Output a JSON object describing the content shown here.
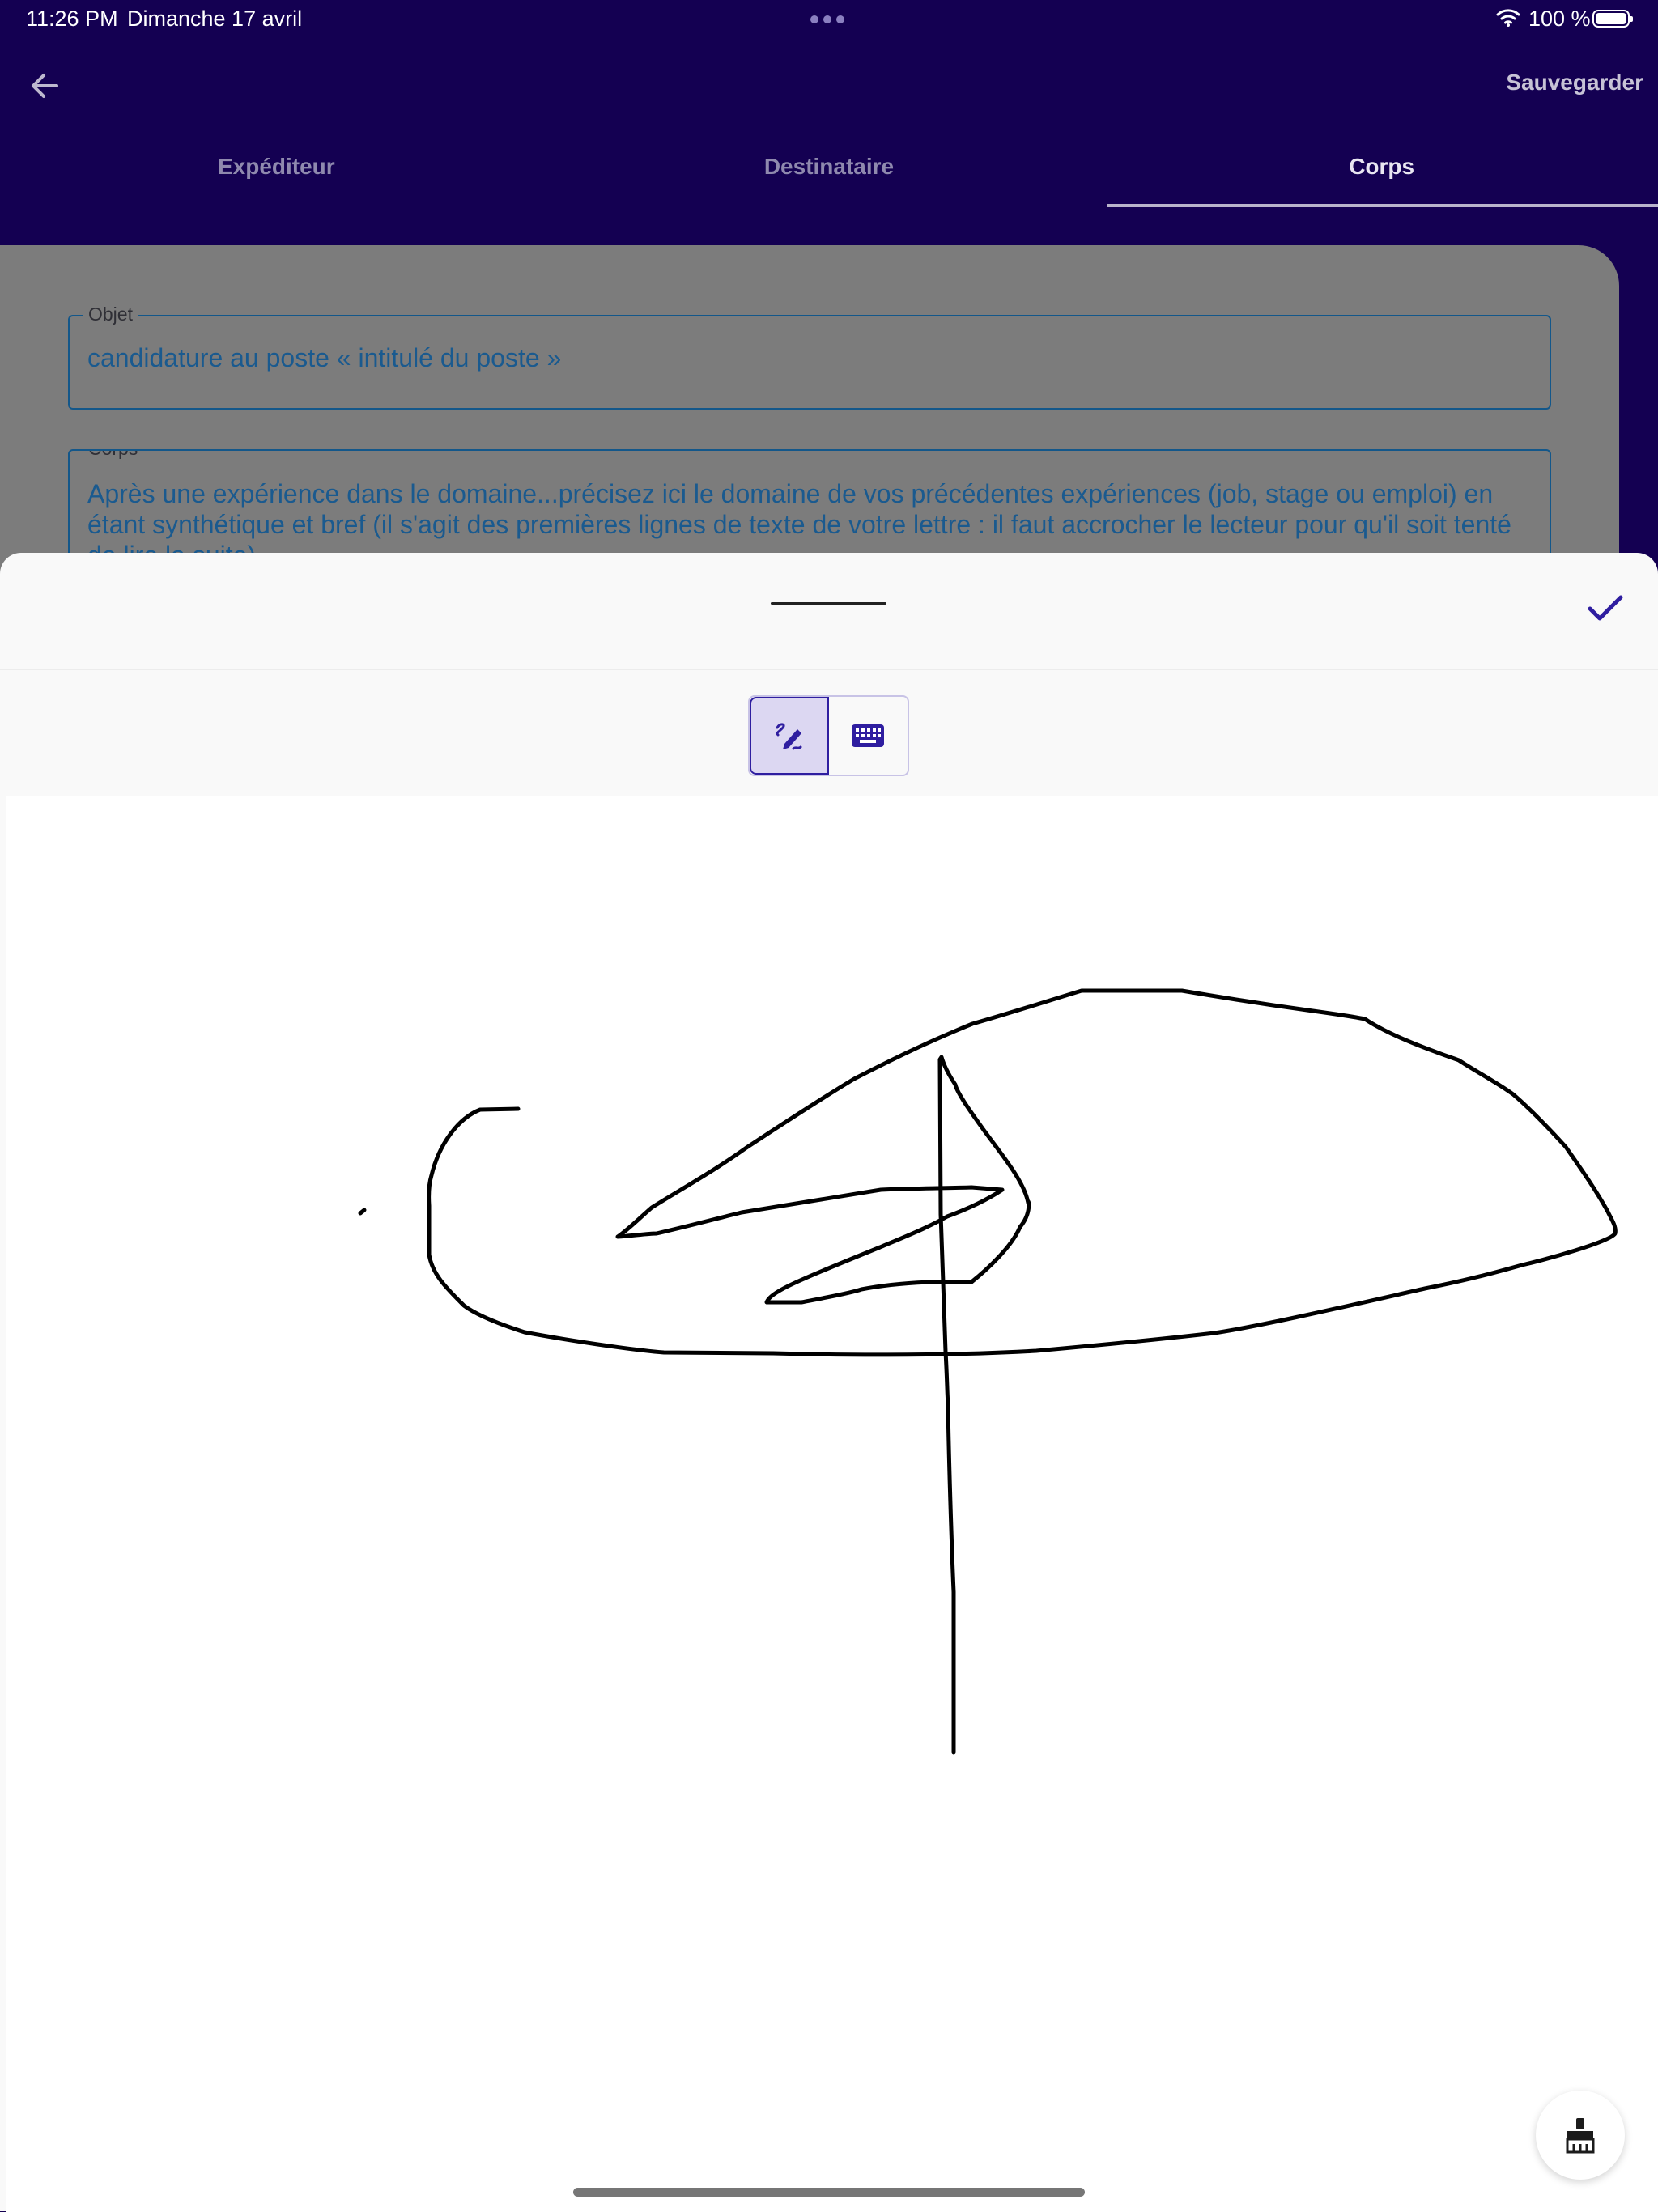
{
  "status_bar": {
    "time": "11:26 PM",
    "date": "Dimanche 17 avril",
    "battery": "100 %",
    "icons": [
      "more-dots-icon",
      "wifi-icon",
      "battery-icon"
    ]
  },
  "header": {
    "save_label": "Sauvegarder",
    "back_icon": "arrow-left-icon"
  },
  "tabs": [
    {
      "label": "Expéditeur",
      "active": false
    },
    {
      "label": "Destinataire",
      "active": false
    },
    {
      "label": "Corps",
      "active": true
    }
  ],
  "form": {
    "objet": {
      "label": "Objet",
      "value": "candidature au poste « intitulé du poste »"
    },
    "corps": {
      "label": "Corps",
      "value": "Après une expérience dans le domaine...précisez ici le domaine de vos précédentes expériences (job, stage ou emploi) en étant synthétique et bref (il s'agit des premières lignes de texte de votre lettre : il faut accrocher le lecteur pour qu'il soit tenté de lire la suite)"
    }
  },
  "signature_sheet": {
    "confirm_icon": "checkmark-icon",
    "modes": [
      {
        "name": "draw",
        "icon": "pencil-draw-icon",
        "selected": true
      },
      {
        "name": "keyboard",
        "icon": "keyboard-icon",
        "selected": false
      }
    ],
    "clear_icon": "broom-icon"
  },
  "colors": {
    "primary": "#140052",
    "accent": "#2f1ea0",
    "field_text": "#1a5a8f",
    "stroke": "#000000"
  }
}
